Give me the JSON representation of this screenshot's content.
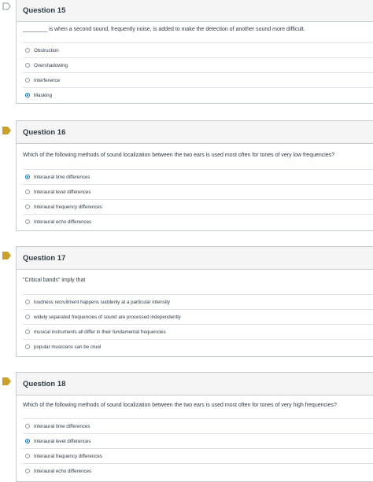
{
  "questions": [
    {
      "title": "Question 15",
      "text": "________ is when a second sound, frequently noise, is added to make the detection of another sound more difficult.",
      "answers": [
        "Obstruction",
        "Overshadowing",
        "Interference",
        "Masking"
      ],
      "selected_index": 3,
      "flagged": false
    },
    {
      "title": "Question 16",
      "text": "Which of the following methods of sound localization between the two ears is used most often for tones of very low frequencies?",
      "answers": [
        "Interaural time differences",
        "Interaural level differences",
        "Interaural frequency differences",
        "Interaural echo differences"
      ],
      "selected_index": 0,
      "flagged": true
    },
    {
      "title": "Question 17",
      "text": "\"Critical bands\" imply that",
      "answers": [
        "loudness recruitment happens suddenly at a particular intensity",
        "widely separated frequencies of sound are processed independently",
        "musical instruments all differ in their fundamental frequencies",
        "popular musicians can be cruel"
      ],
      "selected_index": null,
      "flagged": true
    },
    {
      "title": "Question 18",
      "text": "Which of the following methods of sound localization between the two ears is used most often for tones of very high frequencies?",
      "answers": [
        "Interaural time differences",
        "Interaural level differences",
        "Interaural frequency differences",
        "Interaural echo differences"
      ],
      "selected_index": 1,
      "flagged": true
    }
  ],
  "colors": {
    "flag_filled": "#c8a02a",
    "flag_outline": "#8b969e",
    "radio_selected": "#0374b5"
  },
  "icons": {
    "flag": "bookmark-flag-icon"
  }
}
